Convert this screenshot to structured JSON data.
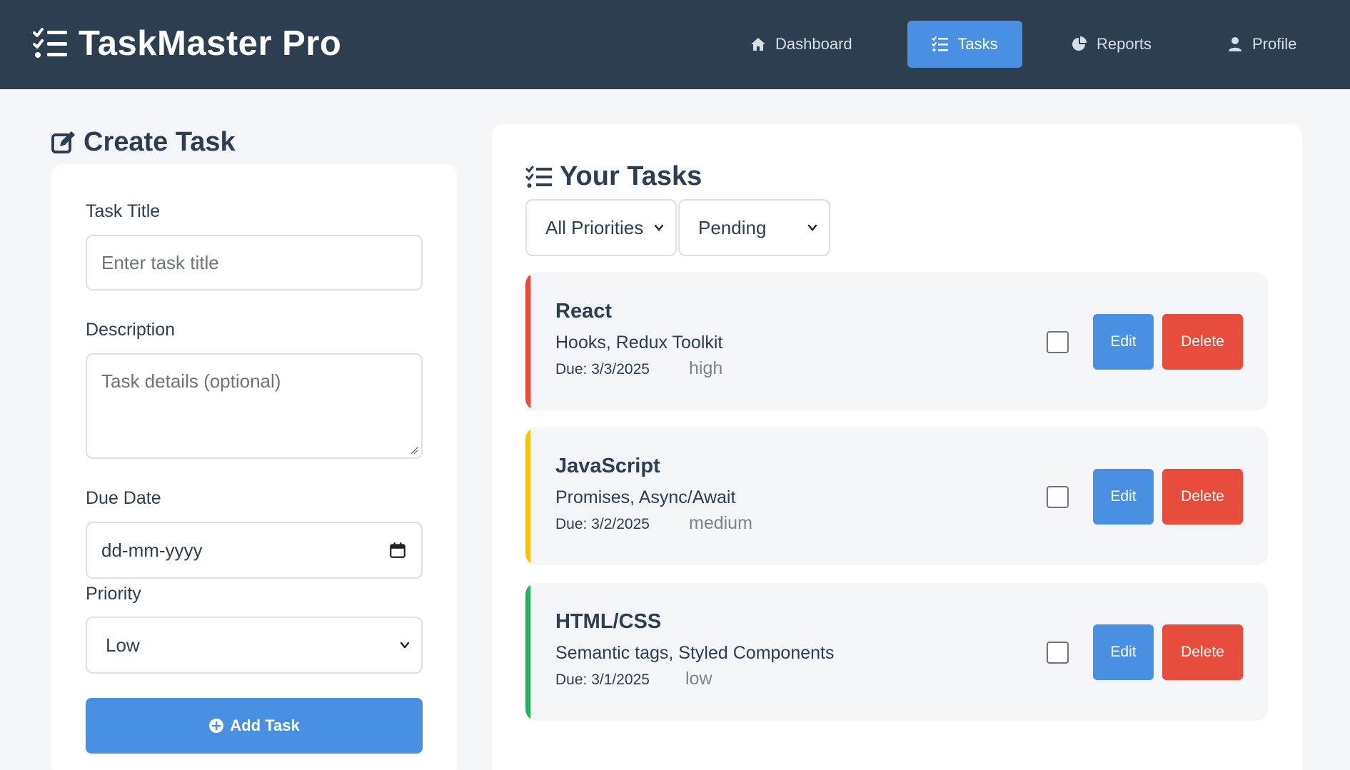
{
  "app": {
    "title": "TaskMaster Pro"
  },
  "nav": {
    "items": [
      {
        "label": "Dashboard",
        "icon": "home-icon"
      },
      {
        "label": "Tasks",
        "icon": "list-check-icon",
        "active": true
      },
      {
        "label": "Reports",
        "icon": "pie-chart-icon"
      },
      {
        "label": "Profile",
        "icon": "user-icon"
      }
    ]
  },
  "create_form": {
    "heading": "Create Task",
    "title_label": "Task Title",
    "title_placeholder": "Enter task title",
    "description_label": "Description",
    "description_placeholder": "Task details (optional)",
    "due_label": "Due Date",
    "due_value": "dd-mm-yyyy",
    "priority_label": "Priority",
    "priority_value": "Low",
    "add_button": "Add Task"
  },
  "tasks_panel": {
    "heading": "Your Tasks",
    "priority_filter": "All Priorities",
    "status_filter": "Pending",
    "tasks": [
      {
        "title": "React",
        "description": "Hooks, Redux Toolkit",
        "due": "Due: 3/3/2025",
        "priority": "high",
        "color": "#e74c3c",
        "done": false
      },
      {
        "title": "JavaScript",
        "description": "Promises, Async/Await",
        "due": "Due: 3/2/2025",
        "priority": "medium",
        "color": "#f1c40f",
        "done": false
      },
      {
        "title": "HTML/CSS",
        "description": "Semantic tags, Styled Components",
        "due": "Due: 3/1/2025",
        "priority": "low",
        "color": "#27ae60",
        "done": false
      }
    ],
    "edit_label": "Edit",
    "delete_label": "Delete"
  },
  "colors": {
    "header_bg": "#2c3e50",
    "accent": "#4a90e2",
    "danger": "#e74c3c",
    "page_bg": "#f3f5f8"
  }
}
